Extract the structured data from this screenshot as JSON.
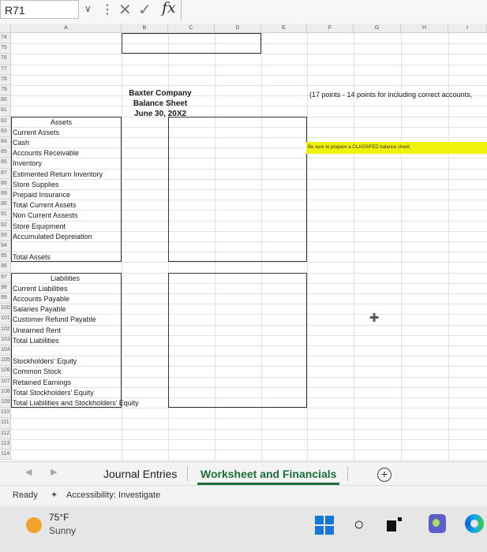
{
  "formula_bar": {
    "name_box": "R71",
    "fx_label": "fx"
  },
  "columns": [
    "A",
    "B",
    "C",
    "D",
    "E",
    "F",
    "G",
    "H",
    "I"
  ],
  "rows": [
    "74",
    "75",
    "76",
    "77",
    "78",
    "79",
    "80",
    "81",
    "82",
    "83",
    "84",
    "85",
    "86",
    "87",
    "88",
    "89",
    "90",
    "91",
    "92",
    "93",
    "94",
    "95",
    "96",
    "97",
    "98",
    "99",
    "100",
    "101",
    "102",
    "103",
    "104",
    "105",
    "106",
    "107",
    "108",
    "109",
    "110",
    "111",
    "112",
    "113",
    "114"
  ],
  "balance_sheet": {
    "company": "Baxter Company",
    "statement": "Balance Sheet",
    "date": "June 30, 20X2",
    "points_note": "(17 points - 14 points for including correct accounts,",
    "highlight_note": "Be sure to prepare a CLASSIFED balance sheet.",
    "labels": [
      {
        "row": "82",
        "text": "Assets",
        "indent": 2
      },
      {
        "row": "83",
        "text": "Current Assets",
        "indent": 0
      },
      {
        "row": "84",
        "text": "Cash",
        "indent": 0
      },
      {
        "row": "85",
        "text": "Accounts Receivable",
        "indent": 0
      },
      {
        "row": "86",
        "text": "Inventory",
        "indent": 0
      },
      {
        "row": "87",
        "text": "Estimented Return Inventory",
        "indent": 0
      },
      {
        "row": "88",
        "text": "Store Supplies",
        "indent": 0
      },
      {
        "row": "89",
        "text": "Prepaid Insurance",
        "indent": 0
      },
      {
        "row": "90",
        "text": "Total Current Assets",
        "indent": 0
      },
      {
        "row": "91",
        "text": "Non Current Assests",
        "indent": 0
      },
      {
        "row": "92",
        "text": "Store Equipment",
        "indent": 0
      },
      {
        "row": "93",
        "text": "Accumulated Depreiation",
        "indent": 0
      },
      {
        "row": "95",
        "text": "Total Assets",
        "indent": 0
      },
      {
        "row": "97",
        "text": "Liabilities",
        "indent": 2
      },
      {
        "row": "98",
        "text": "Current Liabilities",
        "indent": 0
      },
      {
        "row": "99",
        "text": "Accounts Payable",
        "indent": 0
      },
      {
        "row": "100",
        "text": "Salaries Payable",
        "indent": 0
      },
      {
        "row": "101",
        "text": "Customer Refund Payable",
        "indent": 0
      },
      {
        "row": "102",
        "text": "Unearned Rent",
        "indent": 0
      },
      {
        "row": "103",
        "text": "Total Liabilities",
        "indent": 0
      },
      {
        "row": "105",
        "text": "Stockholders' Equity",
        "indent": 0
      },
      {
        "row": "106",
        "text": "Common Stock",
        "indent": 0
      },
      {
        "row": "107",
        "text": "Retained Earnings",
        "indent": 0
      },
      {
        "row": "108",
        "text": "Total Stockholders' Equity",
        "indent": 0
      },
      {
        "row": "109",
        "text": "Total Liabilities and Stockholders' Equity",
        "indent": 0
      }
    ]
  },
  "sheet_tabs": [
    {
      "label": "Journal Entries",
      "active": false
    },
    {
      "label": "Worksheet and Financials",
      "active": true
    }
  ],
  "status_bar": {
    "ready": "Ready",
    "accessibility": "Accessibility: Investigate"
  },
  "taskbar": {
    "temperature": "75°F",
    "condition": "Sunny"
  },
  "colors": {
    "active_tab": "#1e6b3a",
    "highlight": "#f1f20b",
    "windows_blue": "#1877d6"
  }
}
